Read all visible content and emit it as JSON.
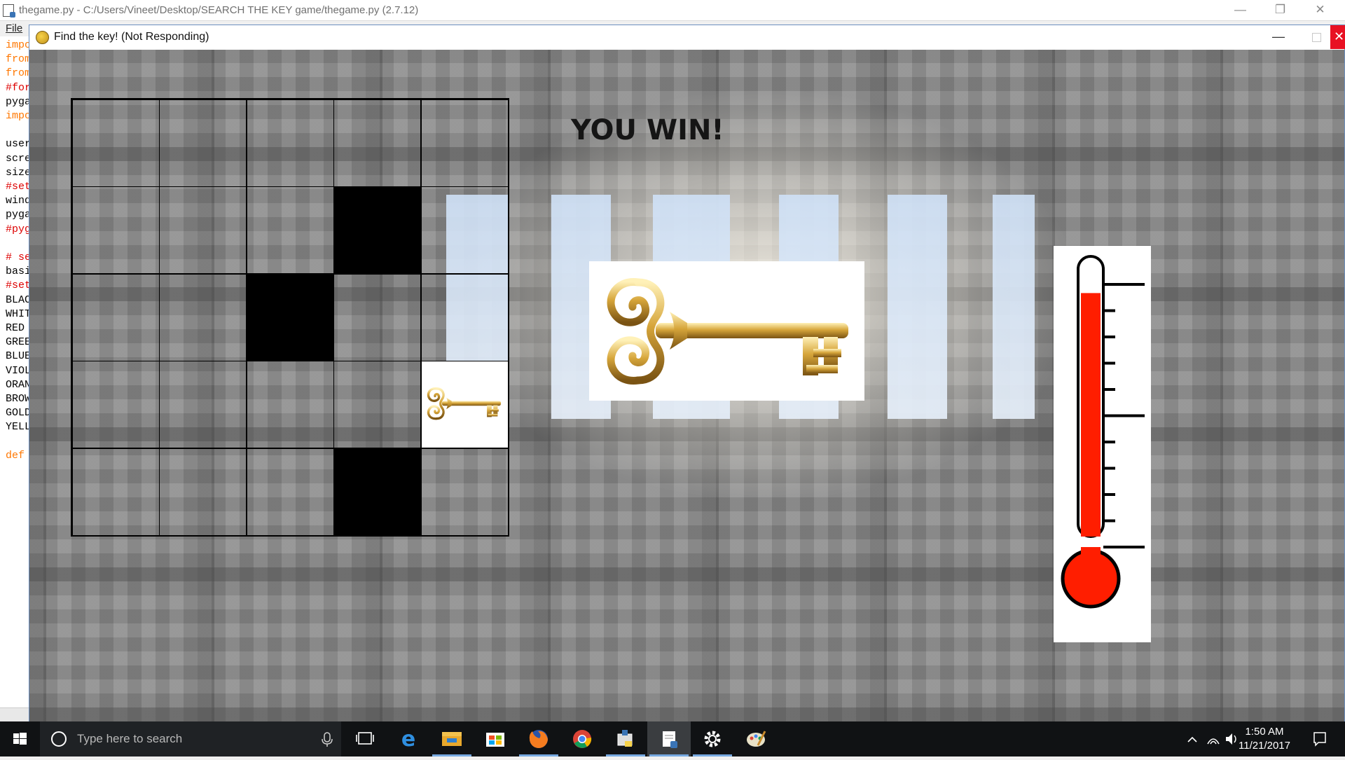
{
  "editor": {
    "title": "thegame.py - C:/Users/Vineet/Desktop/SEARCH THE KEY game/thegame.py (2.7.12)",
    "menu_file": "File",
    "code_lines": [
      {
        "text": "impo",
        "color": "#ff7700"
      },
      {
        "text": "from",
        "color": "#ff7700"
      },
      {
        "text": "from",
        "color": "#ff7700"
      },
      {
        "text": "#for",
        "color": "#dd0000"
      },
      {
        "text": "pyga",
        "color": "#000000"
      },
      {
        "text": "impo",
        "color": "#ff7700"
      },
      {
        "text": "",
        "color": "#000000"
      },
      {
        "text": "user",
        "color": "#000000"
      },
      {
        "text": "scre",
        "color": "#000000"
      },
      {
        "text": "size",
        "color": "#000000"
      },
      {
        "text": "#set",
        "color": "#dd0000"
      },
      {
        "text": "wind",
        "color": "#000000"
      },
      {
        "text": "pyga",
        "color": "#000000"
      },
      {
        "text": "#pyg",
        "color": "#dd0000"
      },
      {
        "text": "",
        "color": "#000000"
      },
      {
        "text": "# se",
        "color": "#dd0000"
      },
      {
        "text": "basi",
        "color": "#000000"
      },
      {
        "text": "#set",
        "color": "#dd0000"
      },
      {
        "text": "BLAC",
        "color": "#000000"
      },
      {
        "text": "WHIT",
        "color": "#000000"
      },
      {
        "text": "RED",
        "color": "#000000"
      },
      {
        "text": "GREE",
        "color": "#000000"
      },
      {
        "text": "BLUE",
        "color": "#000000"
      },
      {
        "text": "VIOL",
        "color": "#000000"
      },
      {
        "text": "ORAN",
        "color": "#000000"
      },
      {
        "text": "BROW",
        "color": "#000000"
      },
      {
        "text": "GOLD",
        "color": "#000000"
      },
      {
        "text": "YELL",
        "color": "#000000"
      },
      {
        "text": "",
        "color": "#000000"
      },
      {
        "text": "def",
        "color": "#ff7700"
      }
    ]
  },
  "game_window": {
    "title": "Find the key! (Not Responding)",
    "message": "YOU WIN!",
    "grid": [
      [
        "empty",
        "empty",
        "empty",
        "empty",
        "empty"
      ],
      [
        "empty",
        "empty",
        "empty",
        "black",
        "empty"
      ],
      [
        "empty",
        "empty",
        "black",
        "empty",
        "empty"
      ],
      [
        "empty",
        "empty",
        "empty",
        "empty",
        "key"
      ],
      [
        "empty",
        "empty",
        "empty",
        "black",
        "empty"
      ]
    ],
    "thermometer_level": 0.88,
    "thermometer_color": "#ff1e00"
  },
  "taskbar": {
    "search_placeholder": "Type here to search",
    "time": "1:50 AM",
    "date": "11/21/2017",
    "apps": [
      "task-view-icon",
      "edge-icon",
      "file-explorer-icon",
      "store-icon",
      "firefox-icon",
      "chrome-icon",
      "python-launcher-icon",
      "idle-editor-icon",
      "settings-icon",
      "paint-icon"
    ]
  }
}
